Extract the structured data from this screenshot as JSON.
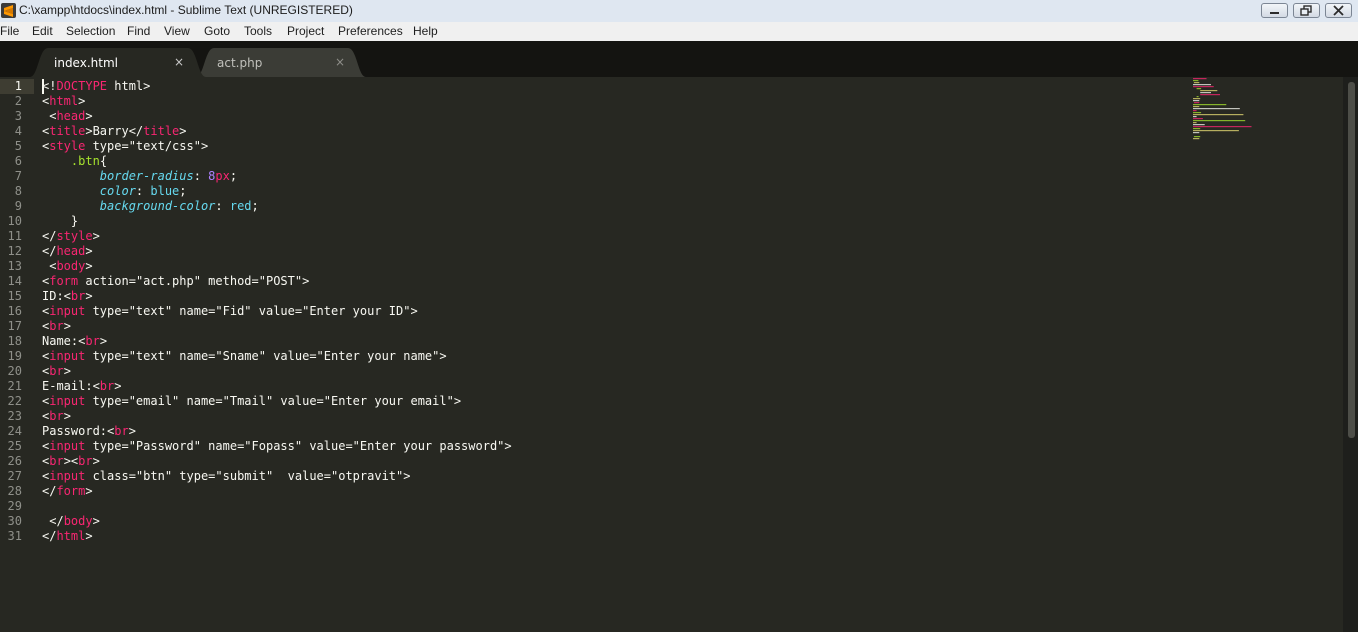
{
  "window": {
    "title": "C:\\xampp\\htdocs\\index.html - Sublime Text (UNREGISTERED)"
  },
  "menu": [
    "File",
    "Edit",
    "Selection",
    "Find",
    "View",
    "Goto",
    "Tools",
    "Project",
    "Preferences",
    "Help"
  ],
  "tabs": [
    {
      "label": "index.html",
      "active": true,
      "close": "×"
    },
    {
      "label": "act.php",
      "active": false,
      "close": "×"
    }
  ],
  "icons": {
    "nav_left": "◀",
    "nav_right": "▶",
    "tab_dropdown": "▼"
  },
  "editor": {
    "active_line": 1,
    "lines": [
      "<!DOCTYPE html>",
      "<html>",
      " <head>",
      "<title>Barry</title>",
      "<style type=\"text/css\">",
      "    .btn{",
      "        border-radius: 8px;",
      "        color: blue;",
      "        background-color: red;",
      "    }",
      "</style>",
      "</head>",
      " <body>",
      "<form action=\"act.php\" method=\"POST\">",
      "ID:<br>",
      "<input type=\"text\" name=\"Fid\" value=\"Enter your ID\">",
      "<br>",
      "Name:<br>",
      "<input type=\"text\" name=\"Sname\" value=\"Enter your name\">",
      "<br>",
      "E-mail:<br>",
      "<input type=\"email\" name=\"Tmail\" value=\"Enter your email\">",
      "<br>",
      "Password:<br>",
      "<input type=\"Password\" name=\"Fopass\" value=\"Enter your password\">",
      "<br><br>",
      "<input class=\"btn\" type=\"submit\"  value=\"otpravit\">",
      "</form>",
      "",
      " </body>",
      "</html>"
    ]
  },
  "colors": {
    "background": "#272822",
    "tag": "#f92672",
    "attribute": "#a6e22e",
    "string": "#e6db74",
    "property": "#66d9ef",
    "number": "#ae81ff"
  }
}
